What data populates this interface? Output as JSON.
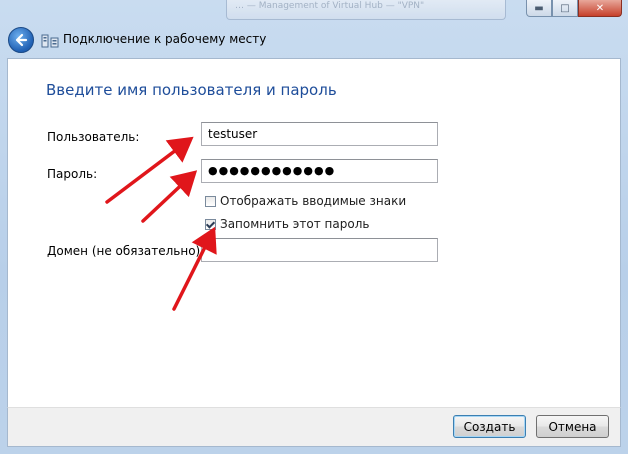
{
  "window": {
    "title": "Подключение к рабочему месту",
    "background_title": "… — Management of Virtual Hub — \"VPN\""
  },
  "form": {
    "heading": "Введите имя пользователя и пароль",
    "username_label": "Пользователь:",
    "username_value": "testuser",
    "password_label": "Пароль:",
    "password_value": "●●●●●●●●●●●●",
    "show_chars_label": "Отображать вводимые знаки",
    "show_chars_checked": false,
    "remember_label": "Запомнить этот пароль",
    "remember_checked": true,
    "domain_label": "Домен (не обязательно):",
    "domain_value": ""
  },
  "buttons": {
    "create": "Создать",
    "cancel": "Отмена"
  },
  "colors": {
    "heading": "#1e4d9a",
    "annotation_arrows": "#e0161b",
    "chrome": "#c9dcf0"
  },
  "icons": [
    "back-arrow-icon",
    "network-connection-icon",
    "minimize-icon",
    "maximize-icon",
    "close-icon"
  ]
}
